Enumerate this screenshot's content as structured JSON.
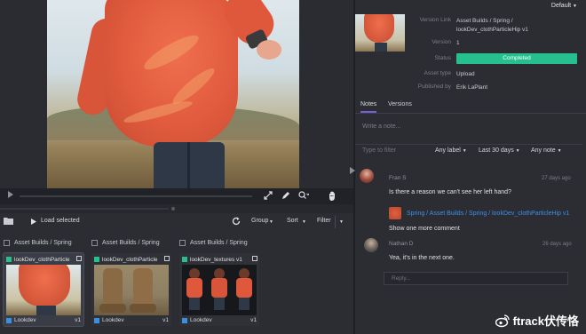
{
  "viewer": {
    "play_icon": "play-icon",
    "tools": [
      "expand-icon",
      "pencil-icon",
      "zoom-icon",
      "hand-icon"
    ]
  },
  "toolbar": {
    "load_selected": "Load selected",
    "group": "Group",
    "sort": "Sort",
    "filter": "Filter"
  },
  "cards": [
    {
      "group": "Asset Builds / Spring",
      "title": "lookDev_clothParticle",
      "task": "Lookdev",
      "version": "v1",
      "selected": true
    },
    {
      "group": "Asset Builds / Spring",
      "title": "lookDev_clothParticle",
      "task": "Lookdev",
      "version": "v1",
      "selected": false
    },
    {
      "group": "Asset Builds / Spring",
      "title": "lookDev_textures v1",
      "task": "Lookdev",
      "version": "v1",
      "selected": false
    }
  ],
  "info": {
    "default_label": "Default",
    "version_link_key": "Version Link",
    "version_link_line1": "Asset Builds / Spring /",
    "version_link_line2": "lookDev_clothParticleHip v1",
    "version_key": "Version",
    "version_value": "1",
    "status_key": "Status",
    "status_value": "Completed",
    "asset_type_key": "Asset type",
    "asset_type_value": "Upload",
    "published_by_key": "Published by",
    "published_by_value": "Erik LaPlant"
  },
  "tabs": {
    "notes": "Notes",
    "versions": "Versions"
  },
  "notes_panel": {
    "write_placeholder": "Write a note...",
    "filter_placeholder": "Type to filter",
    "any_label": "Any label",
    "last_30": "Last 30 days",
    "any_note": "Any note"
  },
  "notes": [
    {
      "author": "Fran S",
      "time": "27 days ago",
      "text": "Is there a reason we can't see her left hand?",
      "link": "Spring / Asset Builds / Spring / lookDev_clothParticleHip v1",
      "extra": "Show one more comment"
    },
    {
      "author": "Nathan D",
      "time": "26 days ago",
      "text": "Yea, it's in the next one."
    }
  ],
  "reply_placeholder": "Reply...",
  "watermark": "ftrack伏传恪",
  "colors": {
    "completed": "#25c08e",
    "link": "#3d8fe8",
    "tab_underline": "#7a5cd6"
  }
}
